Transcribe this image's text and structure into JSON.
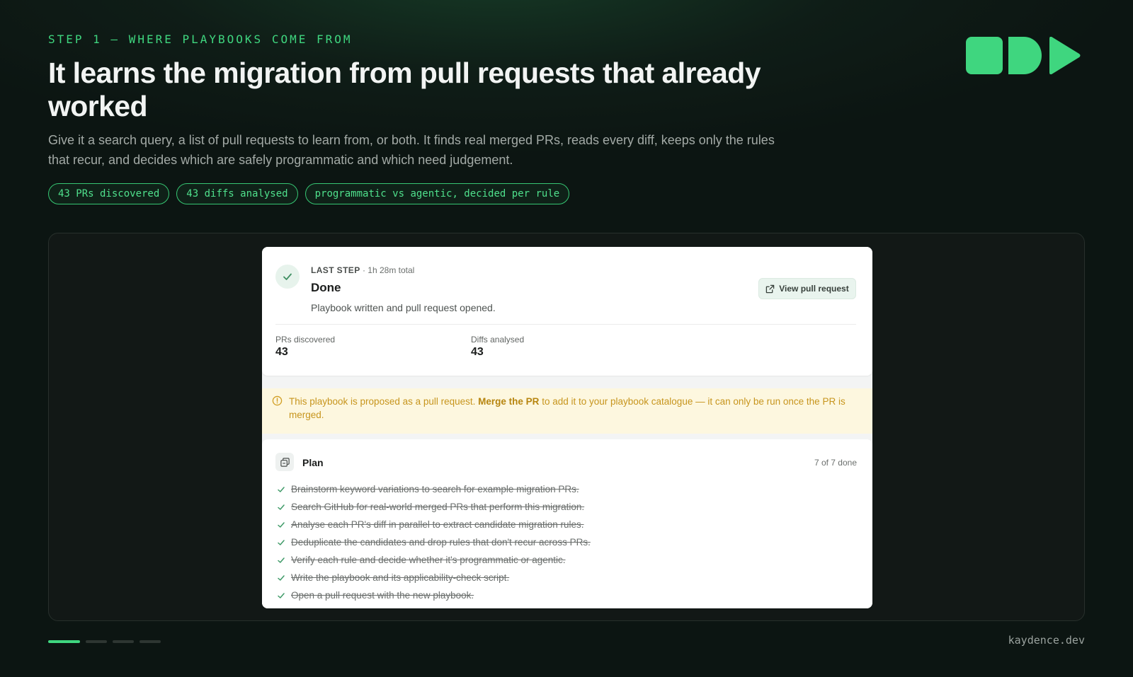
{
  "slide": {
    "eyebrow": "STEP 1 — WHERE PLAYBOOKS COME FROM",
    "title": "It learns the migration from pull requests that already worked",
    "subtitle": "Give it a search query, a list of pull requests to learn from, or both. It finds real merged PRs, reads every diff, keeps only the rules that recur, and decides which are safely programmatic and which need judgement.",
    "pills": [
      "43 PRs discovered",
      "43 diffs analysed",
      "programmatic vs agentic, decided per rule"
    ],
    "footer": "kaydence.dev",
    "progress": {
      "total": 4,
      "current": 1
    },
    "accent": "#3fd67f"
  },
  "app": {
    "step": {
      "label": "LAST STEP",
      "duration": "· 1h 28m total",
      "title": "Done",
      "description": "Playbook written and pull request opened.",
      "view_button": "View pull request"
    },
    "stats": [
      {
        "label": "PRs discovered",
        "value": "43"
      },
      {
        "label": "Diffs analysed",
        "value": "43"
      }
    ],
    "notice": {
      "before": "This playbook is proposed as a pull request. ",
      "bold": "Merge the PR",
      "after": " to add it to your playbook catalogue — it can only be run once the PR is merged."
    },
    "plan": {
      "title": "Plan",
      "count": "7 of 7 done",
      "items": [
        "Brainstorm keyword variations to search for example migration PRs.",
        "Search GitHub for real-world merged PRs that perform this migration.",
        "Analyse each PR's diff in parallel to extract candidate migration rules.",
        "Deduplicate the candidates and drop rules that don't recur across PRs.",
        "Verify each rule and decide whether it's programmatic or agentic.",
        "Write the playbook and its applicability-check script.",
        "Open a pull request with the new playbook."
      ]
    }
  }
}
